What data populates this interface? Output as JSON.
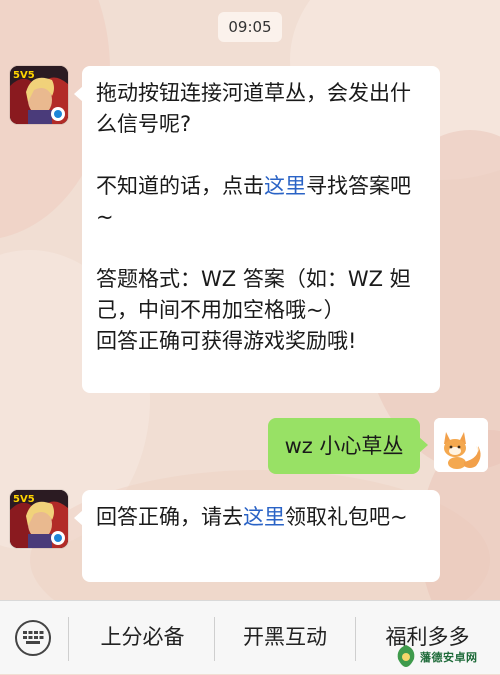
{
  "status": {
    "time": "09:05"
  },
  "messages": {
    "incoming_1": {
      "line_1": "拖动按钮连接河道草丛，会发出什么信号呢?",
      "line_2_prefix": "不知道的话，点击",
      "line_2_link": "这里",
      "line_2_suffix": "寻找答案吧~",
      "line_3": "答题格式：WZ 答案（如：WZ 妲己，中间不用加空格哦~）",
      "line_4": "回答正确可获得游戏奖励哦!"
    },
    "outgoing_1": {
      "text": "wz 小心草丛"
    },
    "incoming_2": {
      "prefix": "回答正确，请去",
      "link": "这里",
      "suffix": "领取礼包吧~"
    }
  },
  "avatars": {
    "official_badge": "5V5",
    "official_icon": "hero-avatar-icon",
    "user_icon": "fox-avatar-icon"
  },
  "menu": {
    "items": [
      "上分必备",
      "开黑互动",
      "福利多多"
    ]
  },
  "watermark": {
    "text": "藩德安卓网"
  },
  "colors": {
    "background": "#f1ded3",
    "incoming_bubble": "#ffffff",
    "outgoing_bubble": "#98e165",
    "link": "#2a63c6",
    "menu_bar": "#f7f7f7"
  }
}
